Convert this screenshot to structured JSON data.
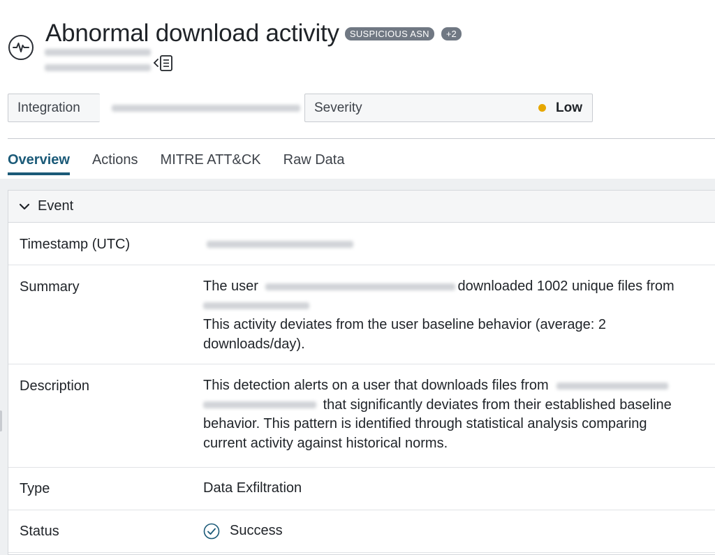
{
  "header": {
    "icon": "activity-pulse-icon",
    "title": "Abnormal download activity",
    "badge": "SUSPICIOUS ASN",
    "badge_more": "+2",
    "panel_icon": "collapse-panel-icon"
  },
  "fields": {
    "integration_label": "Integration",
    "severity_label": "Severity",
    "severity_value": "Low",
    "severity_color": "#e6a700"
  },
  "tabs": [
    {
      "label": "Overview"
    },
    {
      "label": "Actions"
    },
    {
      "label": "MITRE ATT&CK"
    },
    {
      "label": "Raw Data"
    }
  ],
  "event": {
    "section_title": "Event",
    "rows": {
      "timestamp_label": "Timestamp (UTC)",
      "summary_label": "Summary",
      "summary_prefix": "The user",
      "summary_mid": "downloaded 1002 unique files from",
      "summary_line2": "This activity deviates from the user baseline behavior (average: 2 downloads/day).",
      "description_label": "Description",
      "description_prefix": "This detection alerts on a user that downloads files from",
      "description_rest": "that significantly deviates from their established baseline behavior. This pattern is identified through statistical analysis comparing current activity against historical norms.",
      "type_label": "Type",
      "type_value": "Data Exfiltration",
      "status_label": "Status",
      "status_value": "Success",
      "status_icon": "check-circle-icon"
    }
  },
  "colors": {
    "accent": "#1b5a78",
    "badge": "#707883"
  }
}
